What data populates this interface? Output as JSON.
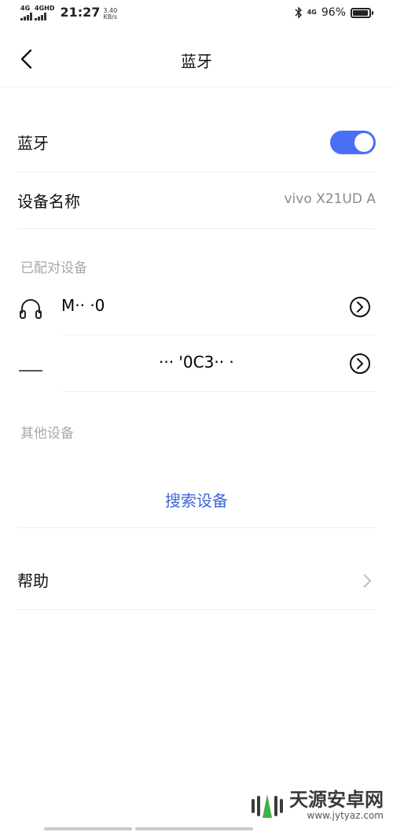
{
  "status_bar": {
    "net1": "4G",
    "net2": "4GHD",
    "time": "21:27",
    "speed_value": "3.40",
    "speed_unit": "KB/s",
    "net_small": "4G",
    "battery_percent": "96%",
    "battery_level": 0.96
  },
  "header": {
    "title": "蓝牙",
    "back_icon": "chevron-left-icon"
  },
  "bluetooth": {
    "label": "蓝牙",
    "enabled": true,
    "accent_color": "#4a6ef5"
  },
  "device_name": {
    "label": "设备名称",
    "value": "vivo X21UD A"
  },
  "paired": {
    "header": "已配对设备",
    "devices": [
      {
        "icon": "headphones-icon",
        "name": "M··  ·0"
      },
      {
        "icon": "device-icon",
        "name": "··· '0C3··  ·"
      }
    ]
  },
  "other": {
    "header": "其他设备",
    "search_label": "搜索设备"
  },
  "help": {
    "label": "帮助"
  },
  "watermark": {
    "text": "天源安卓网",
    "url": "www.jytyaz.com"
  }
}
